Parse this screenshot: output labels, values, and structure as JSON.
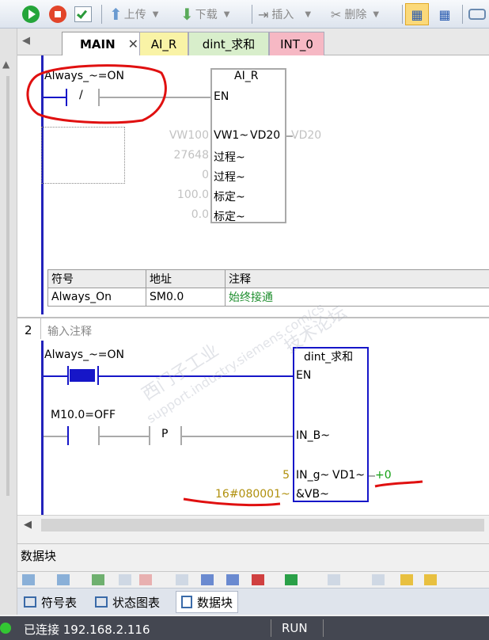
{
  "toolbar": {
    "upload_label": "上传",
    "download_label": "下载",
    "insert_label": "插入",
    "delete_label": "删除"
  },
  "tabs": [
    {
      "label": "MAIN",
      "color": "#ffffff"
    },
    {
      "label": "AI_R",
      "color": "#f9f3a6"
    },
    {
      "label": "dint_求和",
      "color": "#d8eecb"
    },
    {
      "label": "INT_0",
      "color": "#f6b8c4"
    }
  ],
  "network1": {
    "contact_label": "Always_~=ON",
    "contact_symbol": "/",
    "block_title": "AI_R",
    "en": "EN",
    "inputs": [
      {
        "value": "VW100",
        "pin": "VW1~"
      },
      {
        "value": "27648",
        "pin": "过程~"
      },
      {
        "value": "0",
        "pin": "过程~"
      },
      {
        "value": "100.0",
        "pin": "标定~"
      },
      {
        "value": "0.0",
        "pin": "标定~"
      }
    ],
    "output_pin": "VD20",
    "output_value": "VD20",
    "symbol_table": {
      "headers": [
        "符号",
        "地址",
        "注释"
      ],
      "rows": [
        [
          "Always_On",
          "SM0.0",
          "始终接通"
        ]
      ]
    }
  },
  "network2": {
    "number": "2",
    "comment": "输入注释",
    "contact1_label": "Always_~=ON",
    "contact2_label": "M10.0=OFF",
    "p_label": "P",
    "block_title": "dint_求和",
    "en": "EN",
    "in_b": "IN_B~",
    "in_g_value": "5",
    "in_g": "IN_g~",
    "out_pin": "VD1~",
    "out_value": "+0",
    "vb_value": "16#080001~",
    "vb_pin": "&VB~"
  },
  "watermark": {
    "line1": "西门子工业",
    "line2": "support.industry.siemens.com/cs",
    "line3": "技术论坛"
  },
  "panel": {
    "title": "数据块"
  },
  "bottom_tabs": [
    "符号表",
    "状态图表",
    "数据块"
  ],
  "status": {
    "connection": "已连接 192.168.2.116",
    "mode": "RUN"
  }
}
